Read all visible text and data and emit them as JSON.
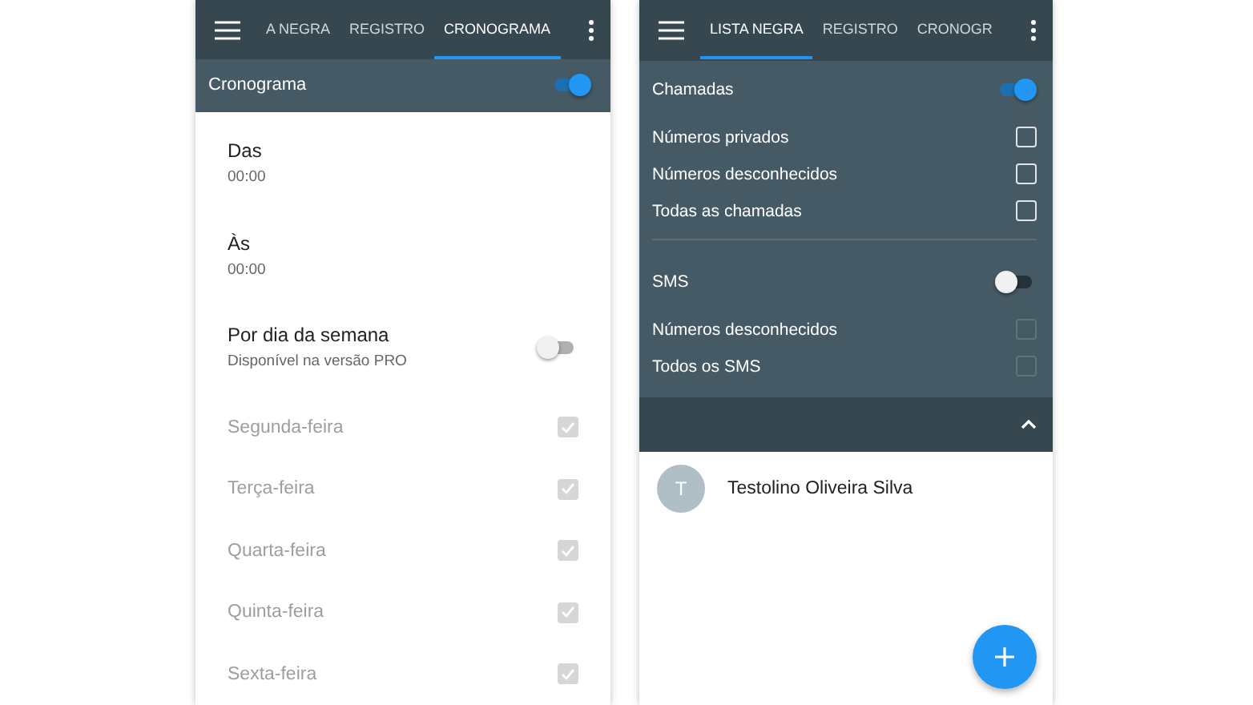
{
  "left_screen": {
    "tabs": [
      {
        "label": "A NEGRA",
        "selected": false
      },
      {
        "label": "REGISTRO",
        "selected": false
      },
      {
        "label": "CRONOGRAMA",
        "selected": true
      }
    ],
    "toolbar": {
      "label": "Cronograma",
      "on": true
    },
    "time_items": [
      {
        "label": "Das",
        "value": "00:00"
      },
      {
        "label": "Às",
        "value": "00:00"
      }
    ],
    "weekday_setting": {
      "label": "Por dia da semana",
      "sublabel": "Disponível na versão PRO",
      "on": false
    },
    "days": [
      {
        "label": "Segunda-feira",
        "checked": true,
        "disabled": true
      },
      {
        "label": "Terça-feira",
        "checked": true,
        "disabled": true
      },
      {
        "label": "Quarta-feira",
        "checked": true,
        "disabled": true
      },
      {
        "label": "Quinta-feira",
        "checked": true,
        "disabled": true
      },
      {
        "label": "Sexta-feira",
        "checked": true,
        "disabled": true
      }
    ]
  },
  "right_screen": {
    "tabs": [
      {
        "label": "LISTA NEGRA",
        "selected": true
      },
      {
        "label": "REGISTRO",
        "selected": false
      },
      {
        "label": "CRONOGR",
        "selected": false
      }
    ],
    "groups": [
      {
        "label": "Chamadas",
        "on": true,
        "options": [
          {
            "label": "Números privados",
            "checked": false,
            "disabled": false
          },
          {
            "label": "Números desconhecidos",
            "checked": false,
            "disabled": false
          },
          {
            "label": "Todas as chamadas",
            "checked": false,
            "disabled": false
          }
        ]
      },
      {
        "label": "SMS",
        "on": false,
        "options": [
          {
            "label": "Números desconhecidos",
            "checked": false,
            "disabled": true
          },
          {
            "label": "Todos os SMS",
            "checked": false,
            "disabled": true
          }
        ]
      }
    ],
    "contacts": [
      {
        "initial": "T",
        "name": "Testolino Oliveira Silva"
      }
    ]
  }
}
